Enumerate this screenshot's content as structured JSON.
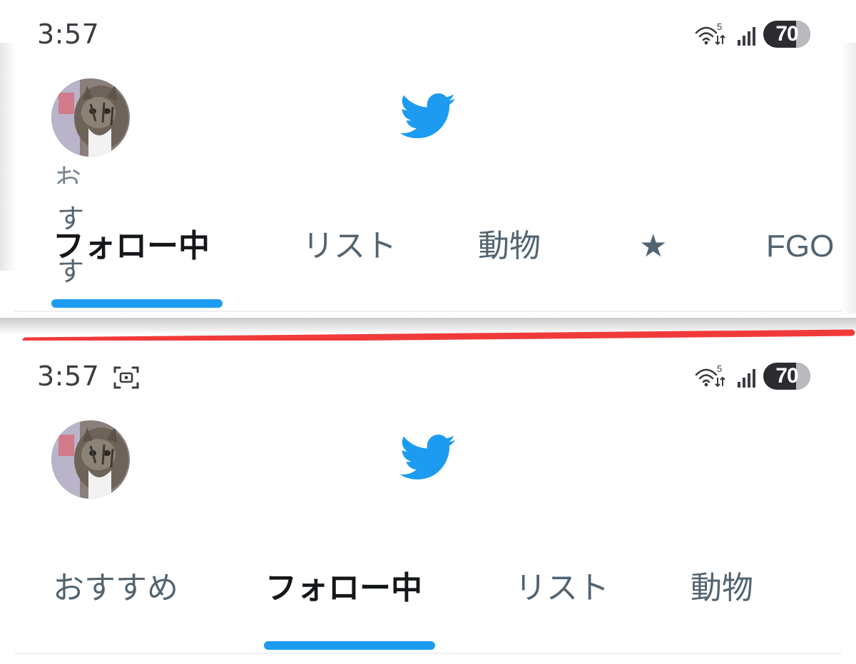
{
  "colors": {
    "twitter_blue": "#1d9bf0",
    "separator_red": "#f03a3a",
    "active_tab_text": "#14171a",
    "inactive_tab_text": "#536471"
  },
  "top": {
    "status": {
      "time": "3:57",
      "network_badge": "5",
      "battery": "70"
    },
    "header_logo": "twitter-bird",
    "tabs": [
      {
        "label": "フォロー中",
        "active": true
      },
      {
        "label": "リスト",
        "active": false
      },
      {
        "label": "動物",
        "active": false
      },
      {
        "label": "★",
        "active": false
      },
      {
        "label": "FGO",
        "active": false
      }
    ],
    "ghost_chars": [
      "お",
      "す",
      "す"
    ]
  },
  "bottom": {
    "status": {
      "time": "3:57",
      "network_badge": "5",
      "battery": "70"
    },
    "header_logo": "twitter-bird",
    "tabs": [
      {
        "label": "おすすめ",
        "active": false
      },
      {
        "label": "フォロー中",
        "active": true
      },
      {
        "label": "リスト",
        "active": false
      },
      {
        "label": "動物",
        "active": false
      }
    ]
  }
}
